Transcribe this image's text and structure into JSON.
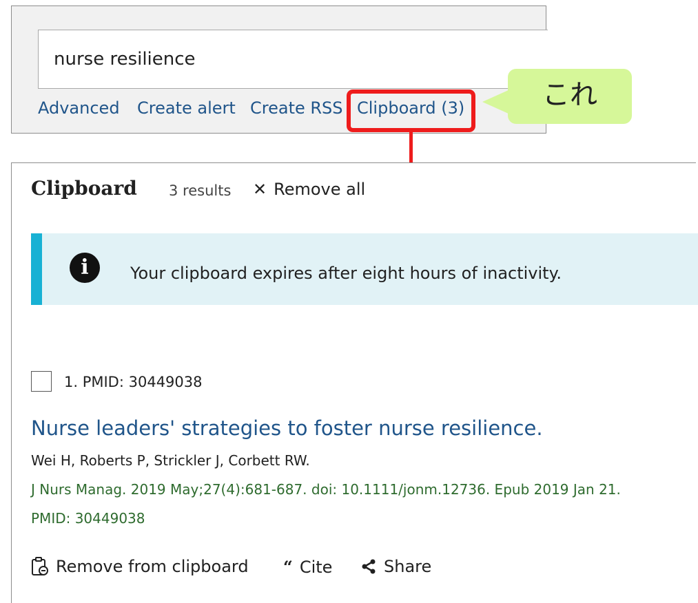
{
  "search": {
    "query": "nurse resilience",
    "links": [
      "Advanced",
      "Create alert",
      "Create RSS",
      "Clipboard (3)"
    ]
  },
  "callout": {
    "text": "これ"
  },
  "clipboard": {
    "title": "Clipboard",
    "count": "3 results",
    "remove_all": "Remove all",
    "info_text": "Your clipboard expires after eight hours of inactivity.",
    "result": {
      "label": "1. PMID: 30449038",
      "title": "Nurse leaders' strategies to foster nurse resilience.",
      "authors": "Wei H, Roberts P, Strickler J, Corbett RW.",
      "citation": "J Nurs Manag. 2019 May;27(4):681-687. doi: 10.1111/jonm.12736. Epub 2019 Jan 21.",
      "pmid": "PMID: 30449038",
      "actions": [
        "Remove from clipboard",
        "Cite",
        "Share"
      ]
    }
  },
  "colors": {
    "link": "#20558a",
    "highlight": "#ee1c1c",
    "callout_bg": "#d6f799",
    "info_bg": "#e1f2f6",
    "info_accent": "#18b1d4",
    "citation": "#2e6b2e"
  }
}
